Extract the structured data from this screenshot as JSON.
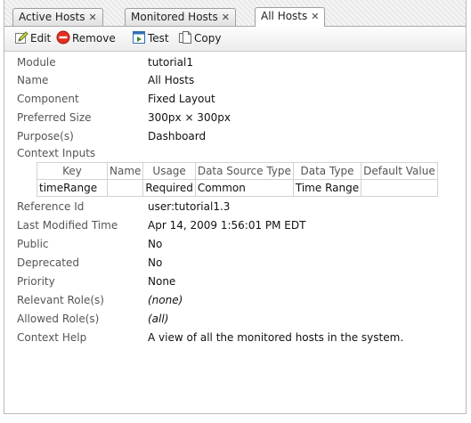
{
  "tabs": [
    {
      "label": "Active Hosts"
    },
    {
      "label": "Monitored Hosts"
    },
    {
      "label": "All Hosts"
    }
  ],
  "toolbar": {
    "edit": "Edit",
    "remove": "Remove",
    "test": "Test",
    "copy": "Copy"
  },
  "props": {
    "module": {
      "label": "Module",
      "value": "tutorial1"
    },
    "name": {
      "label": "Name",
      "value": "All Hosts"
    },
    "component": {
      "label": "Component",
      "value": "Fixed Layout"
    },
    "preferred_size": {
      "label": "Preferred Size",
      "value": "300px × 300px"
    },
    "purpose": {
      "label": "Purpose(s)",
      "value": "Dashboard"
    },
    "context_inputs": {
      "label": "Context Inputs"
    },
    "reference_id": {
      "label": "Reference Id",
      "value": "user:tutorial1.3"
    },
    "last_modified": {
      "label": "Last Modified Time",
      "value": "Apr 14, 2009 1:56:01 PM EDT"
    },
    "public": {
      "label": "Public",
      "value": "No"
    },
    "deprecated": {
      "label": "Deprecated",
      "value": "No"
    },
    "priority": {
      "label": "Priority",
      "value": "None"
    },
    "relevant_roles": {
      "label": "Relevant Role(s)",
      "value": "(none)"
    },
    "allowed_roles": {
      "label": "Allowed Role(s)",
      "value": "(all)"
    },
    "context_help": {
      "label": "Context Help",
      "value": "A view of all the monitored hosts in the system."
    }
  },
  "context_table": {
    "headers": [
      "Key",
      "Name",
      "Usage",
      "Data Source Type",
      "Data Type",
      "Default Value"
    ],
    "rows": [
      [
        "timeRange",
        "",
        "Required",
        "Common",
        "Time Range",
        ""
      ]
    ]
  },
  "colors": {
    "remove_icon": "#e0301e",
    "edit_icon": "#4a8a2a",
    "test_icon": "#3a8a3a"
  },
  "icons": {
    "edit": "edit-icon",
    "remove": "remove-icon",
    "test": "test-icon",
    "copy": "copy-icon"
  }
}
